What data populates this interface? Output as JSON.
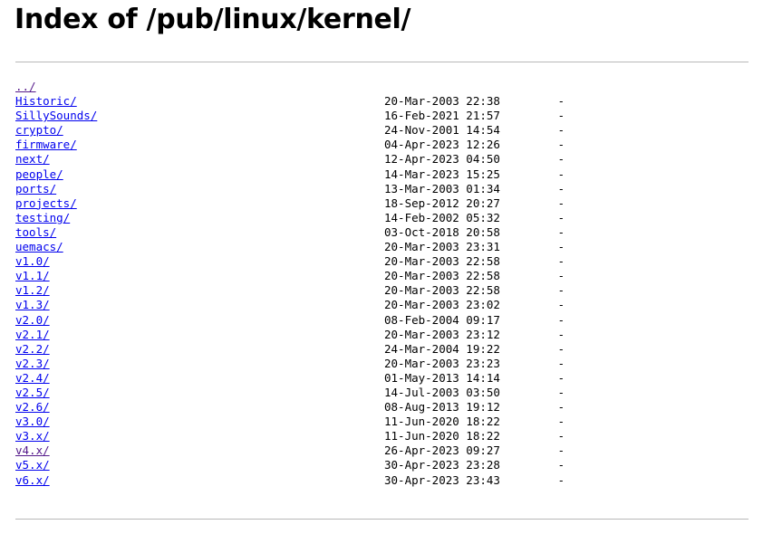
{
  "header": {
    "title": "Index of /pub/linux/kernel/"
  },
  "listing": {
    "parent": {
      "name": "../",
      "date": "",
      "size": "",
      "visited": true
    },
    "entries": [
      {
        "name": "Historic/",
        "date": "20-Mar-2003 22:38",
        "size": "-",
        "visited": false
      },
      {
        "name": "SillySounds/",
        "date": "16-Feb-2021 21:57",
        "size": "-",
        "visited": false
      },
      {
        "name": "crypto/",
        "date": "24-Nov-2001 14:54",
        "size": "-",
        "visited": false
      },
      {
        "name": "firmware/",
        "date": "04-Apr-2023 12:26",
        "size": "-",
        "visited": false
      },
      {
        "name": "next/",
        "date": "12-Apr-2023 04:50",
        "size": "-",
        "visited": false
      },
      {
        "name": "people/",
        "date": "14-Mar-2023 15:25",
        "size": "-",
        "visited": false
      },
      {
        "name": "ports/",
        "date": "13-Mar-2003 01:34",
        "size": "-",
        "visited": false
      },
      {
        "name": "projects/",
        "date": "18-Sep-2012 20:27",
        "size": "-",
        "visited": false
      },
      {
        "name": "testing/",
        "date": "14-Feb-2002 05:32",
        "size": "-",
        "visited": false
      },
      {
        "name": "tools/",
        "date": "03-Oct-2018 20:58",
        "size": "-",
        "visited": false
      },
      {
        "name": "uemacs/",
        "date": "20-Mar-2003 23:31",
        "size": "-",
        "visited": false
      },
      {
        "name": "v1.0/",
        "date": "20-Mar-2003 22:58",
        "size": "-",
        "visited": false
      },
      {
        "name": "v1.1/",
        "date": "20-Mar-2003 22:58",
        "size": "-",
        "visited": false
      },
      {
        "name": "v1.2/",
        "date": "20-Mar-2003 22:58",
        "size": "-",
        "visited": false
      },
      {
        "name": "v1.3/",
        "date": "20-Mar-2003 23:02",
        "size": "-",
        "visited": false
      },
      {
        "name": "v2.0/",
        "date": "08-Feb-2004 09:17",
        "size": "-",
        "visited": false
      },
      {
        "name": "v2.1/",
        "date": "20-Mar-2003 23:12",
        "size": "-",
        "visited": false
      },
      {
        "name": "v2.2/",
        "date": "24-Mar-2004 19:22",
        "size": "-",
        "visited": false
      },
      {
        "name": "v2.3/",
        "date": "20-Mar-2003 23:23",
        "size": "-",
        "visited": false
      },
      {
        "name": "v2.4/",
        "date": "01-May-2013 14:14",
        "size": "-",
        "visited": false
      },
      {
        "name": "v2.5/",
        "date": "14-Jul-2003 03:50",
        "size": "-",
        "visited": false
      },
      {
        "name": "v2.6/",
        "date": "08-Aug-2013 19:12",
        "size": "-",
        "visited": false
      },
      {
        "name": "v3.0/",
        "date": "11-Jun-2020 18:22",
        "size": "-",
        "visited": false
      },
      {
        "name": "v3.x/",
        "date": "11-Jun-2020 18:22",
        "size": "-",
        "visited": false
      },
      {
        "name": "v4.x/",
        "date": "26-Apr-2023 09:27",
        "size": "-",
        "visited": true
      },
      {
        "name": "v5.x/",
        "date": "30-Apr-2023 23:28",
        "size": "-",
        "visited": false
      },
      {
        "name": "v6.x/",
        "date": "30-Apr-2023 23:43",
        "size": "-",
        "visited": false
      }
    ]
  },
  "colors": {
    "link": "#0000ee",
    "visited_link": "#551a8b",
    "rule": "#b8b8b8",
    "text": "#000000",
    "background": "#ffffff"
  }
}
